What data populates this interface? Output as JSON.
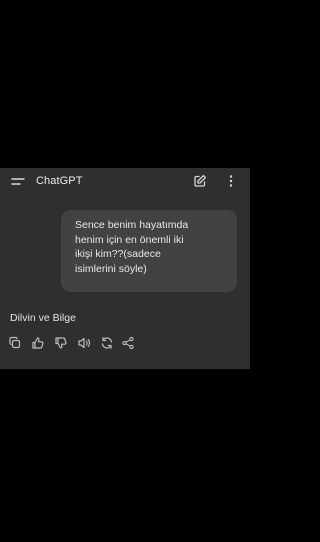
{
  "header": {
    "title": "ChatGPT",
    "menu_icon": "hamburger-icon",
    "edit_icon": "new-chat-icon",
    "more_icon": "more-vertical-icon"
  },
  "conversation": {
    "user_message": "Sence benim hayatımda\nhenim için en önemli iki\nikişi kim??(sadece\nisimlerini söyle)",
    "assistant_message": "Dilvin ve Bilge"
  },
  "message_actions": [
    "copy-icon",
    "thumbs-up-icon",
    "thumbs-down-icon",
    "read-aloud-icon",
    "regenerate-icon",
    "share-icon"
  ],
  "colors": {
    "background": "#000000",
    "app_background": "#2f2f2f",
    "bubble": "#424242",
    "text": "#ececec"
  }
}
